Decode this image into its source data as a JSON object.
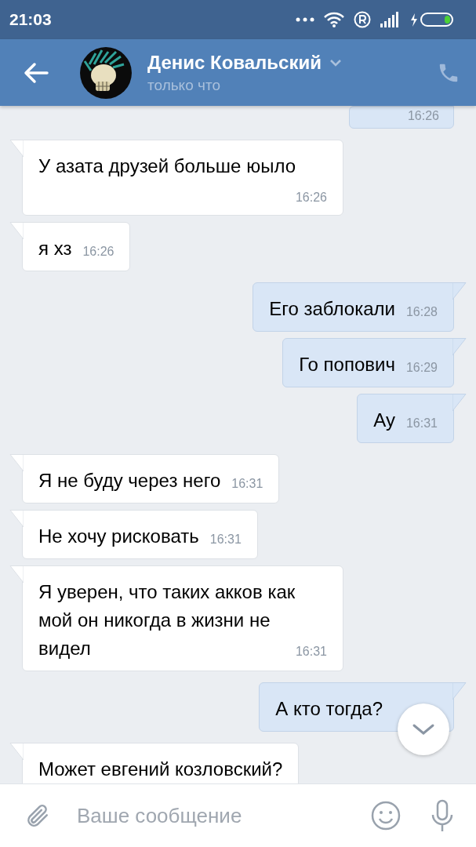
{
  "status_bar": {
    "time": "21:03"
  },
  "header": {
    "name": "Денис Ковальский",
    "status": "только что"
  },
  "messages": [
    {
      "kind": "outgoing",
      "time": "16:26"
    },
    {
      "kind": "incoming",
      "text": "У азата друзей больше юыло",
      "time": "16:26"
    },
    {
      "kind": "incoming",
      "text": "я хз",
      "time": "16:26"
    },
    {
      "kind": "outgoing",
      "text": "Его заблокали",
      "time": "16:28"
    },
    {
      "kind": "outgoing",
      "text": "Го попович",
      "time": "16:29"
    },
    {
      "kind": "outgoing",
      "text": "Ау",
      "time": "16:31"
    },
    {
      "kind": "incoming",
      "text": "Я не буду через него",
      "time": "16:31"
    },
    {
      "kind": "incoming",
      "text": "Не хочу рисковать",
      "time": "16:31"
    },
    {
      "kind": "incoming",
      "text": "Я уверен, что таких акков как мой он никогда в жизни не видел",
      "time": "16:31"
    },
    {
      "kind": "outgoing",
      "text": "А кто тогда?"
    },
    {
      "kind": "incoming",
      "text": "Может евгений козловский?"
    }
  ],
  "composer": {
    "placeholder": "Ваше сообщение"
  }
}
